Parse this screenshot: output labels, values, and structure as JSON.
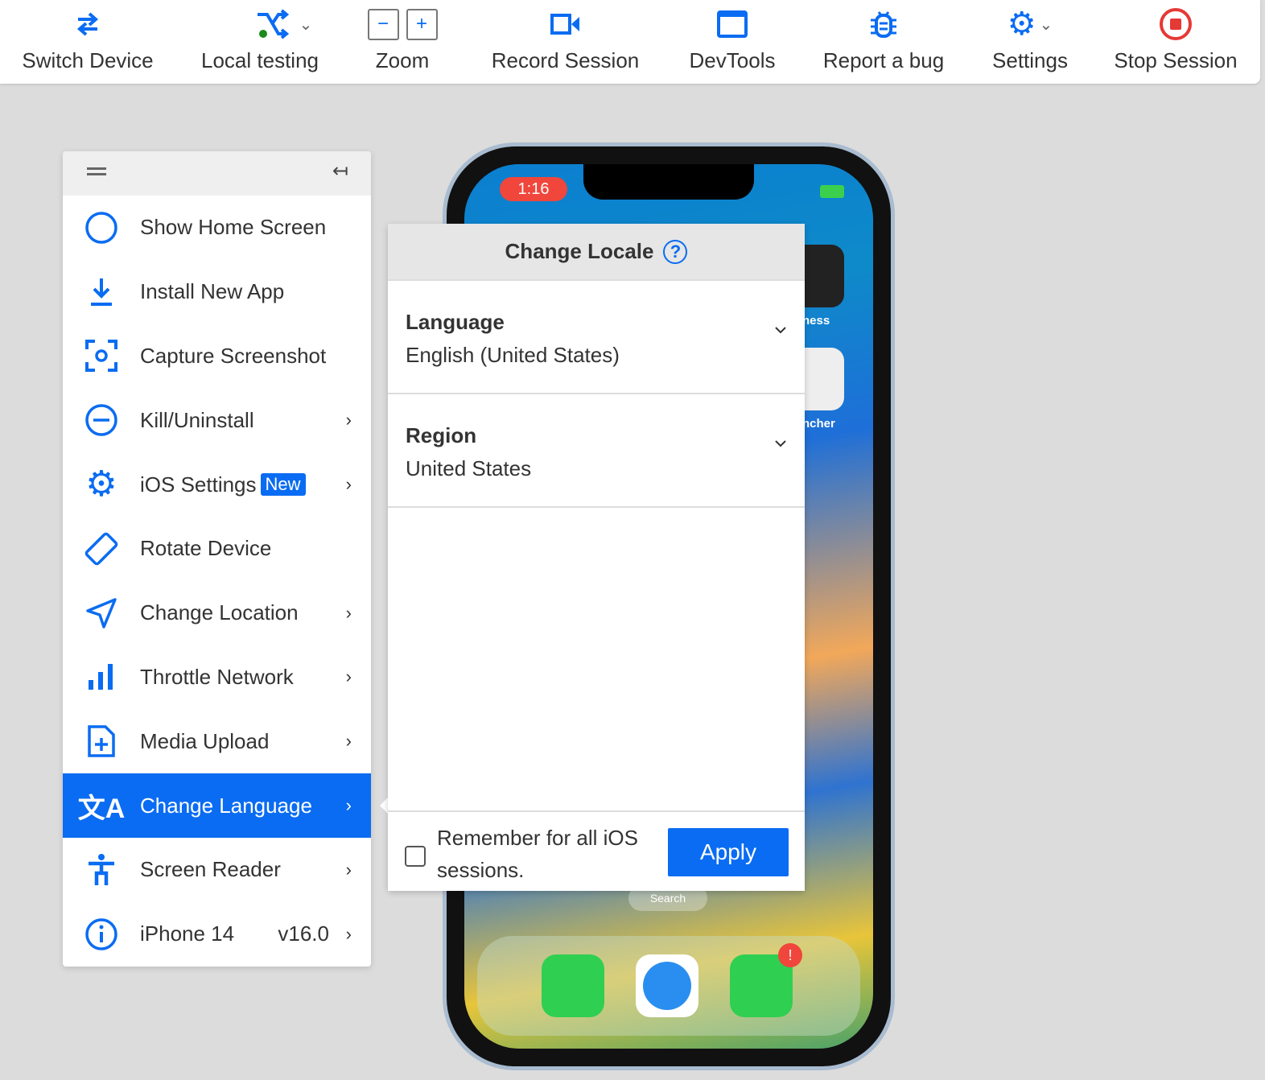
{
  "toolbar": {
    "items": [
      {
        "label": "Switch Device",
        "icon": "switch-arrows-icon"
      },
      {
        "label": "Local testing",
        "icon": "shuffle-icon",
        "status_color": "#1a8a1a"
      },
      {
        "label": "Zoom",
        "zoom_out": "−",
        "zoom_in": "+"
      },
      {
        "label": "Record Session",
        "icon": "video-camera-icon"
      },
      {
        "label": "DevTools",
        "icon": "window-icon"
      },
      {
        "label": "Report a bug",
        "icon": "bug-icon"
      },
      {
        "label": "Settings",
        "icon": "gear-icon"
      },
      {
        "label": "Stop Session",
        "icon": "stop-icon",
        "color": "#e53935"
      }
    ]
  },
  "menu": {
    "items": [
      {
        "label": "Show Home Screen",
        "icon": "circle-icon"
      },
      {
        "label": "Install New App",
        "icon": "download-icon"
      },
      {
        "label": "Capture Screenshot",
        "icon": "screenshot-icon"
      },
      {
        "label": "Kill/Uninstall",
        "icon": "minus-circle-icon"
      },
      {
        "label": "iOS Settings",
        "icon": "gear-icon",
        "badge": "New"
      },
      {
        "label": "Rotate Device",
        "icon": "rotate-icon"
      },
      {
        "label": "Change Location",
        "icon": "location-arrow-icon"
      },
      {
        "label": "Throttle Network",
        "icon": "signal-bars-icon"
      },
      {
        "label": "Media Upload",
        "icon": "file-plus-icon"
      },
      {
        "label": "Change Language",
        "icon": "translate-icon",
        "active": true
      },
      {
        "label": "Screen Reader",
        "icon": "accessibility-icon"
      },
      {
        "label": "iPhone 14",
        "icon": "info-icon",
        "version": "v16.0"
      }
    ]
  },
  "locale": {
    "title": "Change Locale",
    "language_label": "Language",
    "language_value": "English (United States)",
    "region_label": "Region",
    "region_value": "United States",
    "remember": "Remember for all iOS sessions.",
    "remember_checked": false,
    "apply": "Apply"
  },
  "phone": {
    "time": "1:16",
    "app1": "ness",
    "app2": "ncher",
    "search": "Search"
  },
  "colors": {
    "accent": "#0a6cf2",
    "stop": "#e53935"
  }
}
